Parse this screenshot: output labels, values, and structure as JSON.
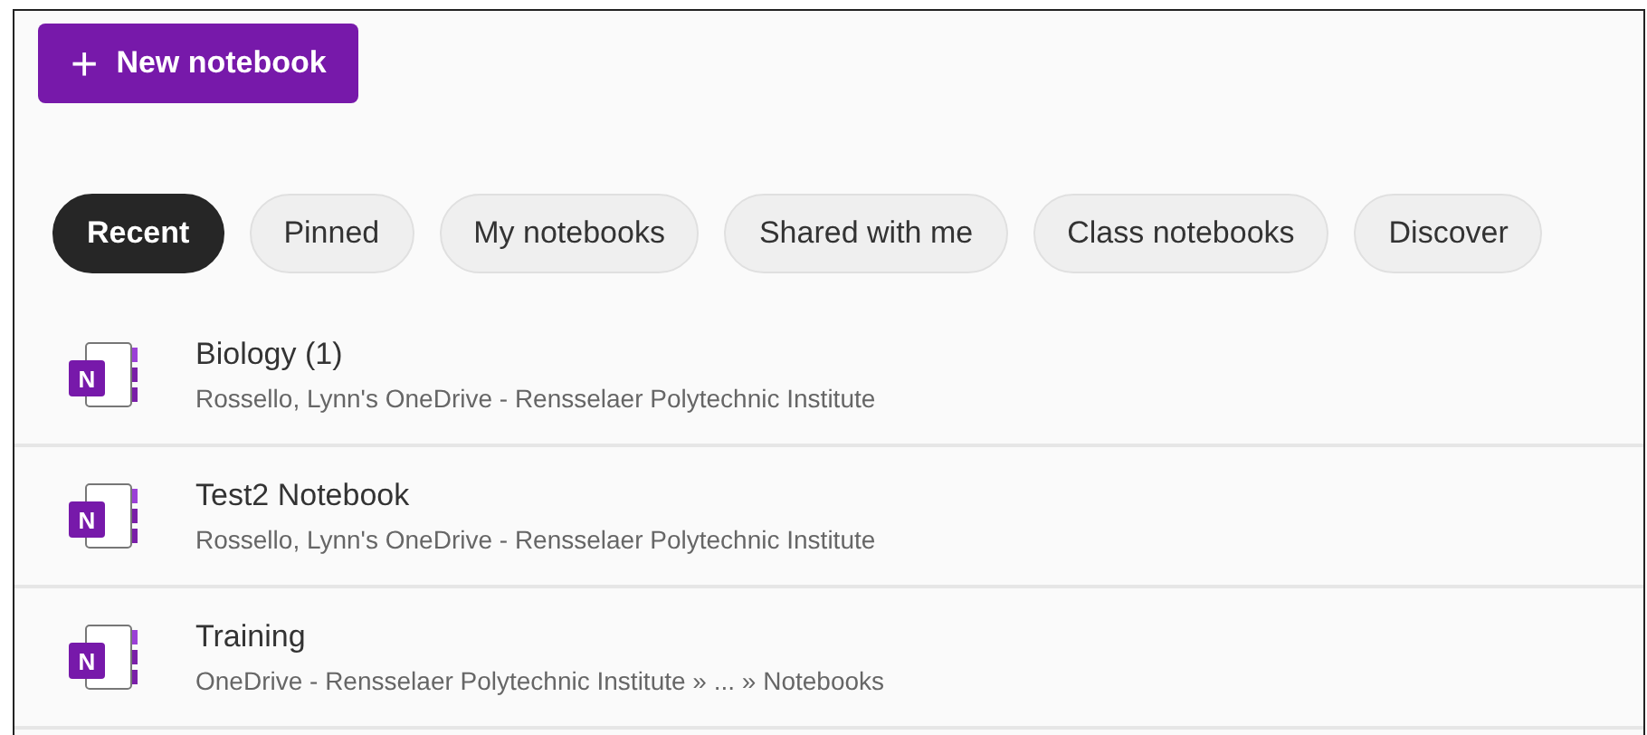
{
  "new_button": {
    "icon": "+",
    "label": "New notebook"
  },
  "tabs": [
    {
      "label": "Recent",
      "selected": true
    },
    {
      "label": "Pinned",
      "selected": false
    },
    {
      "label": "My notebooks",
      "selected": false
    },
    {
      "label": "Shared with me",
      "selected": false
    },
    {
      "label": "Class notebooks",
      "selected": false
    },
    {
      "label": "Discover",
      "selected": false
    }
  ],
  "notebooks": [
    {
      "icon_letter": "N",
      "title": "Biology (1)",
      "location": "Rossello, Lynn's OneDrive - Rensselaer Polytechnic Institute"
    },
    {
      "icon_letter": "N",
      "title": "Test2 Notebook",
      "location": "Rossello, Lynn's OneDrive - Rensselaer Polytechnic Institute"
    },
    {
      "icon_letter": "N",
      "title": "Training",
      "location": "OneDrive - Rensselaer Polytechnic Institute » ... » Notebooks"
    }
  ]
}
